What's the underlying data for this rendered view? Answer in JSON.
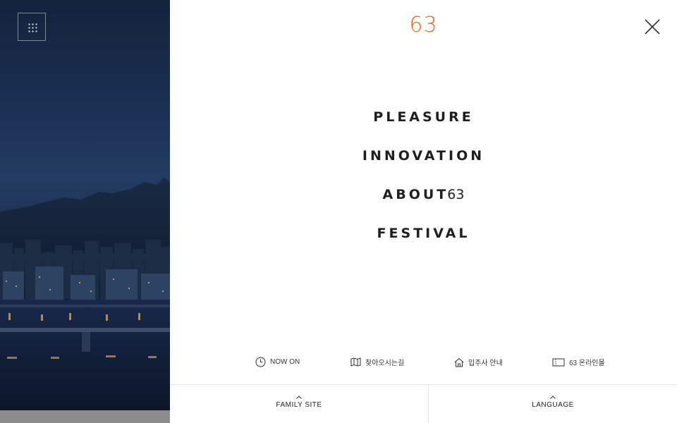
{
  "logo": {
    "text": "63",
    "color": "#e8661a"
  },
  "menu_toggle": {
    "icon": "grid-dots-icon"
  },
  "close": {
    "icon": "close-icon"
  },
  "nav": [
    {
      "label": "PLEASURE"
    },
    {
      "label": "INNOVATION"
    },
    {
      "label": "ABOUT",
      "suffix": "63"
    },
    {
      "label": "FESTIVAL"
    }
  ],
  "quick_links": [
    {
      "label": "NOW ON",
      "icon": "clock-icon"
    },
    {
      "label": "찾아오시는길",
      "icon": "map-icon"
    },
    {
      "label": "입주사 안내",
      "icon": "home-icon"
    },
    {
      "label": "63 온라인몰",
      "icon": "ticket-icon"
    }
  ],
  "footer": {
    "family_site": "FAMILY SITE",
    "language": "LANGUAGE"
  }
}
